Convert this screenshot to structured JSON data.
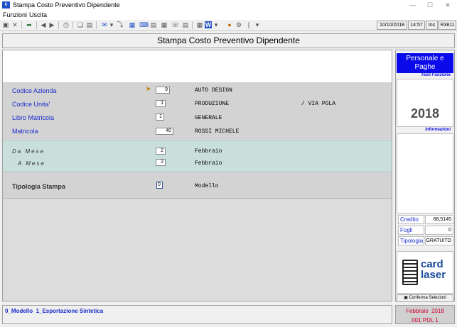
{
  "window": {
    "title": "Stampa Costo Preventivo Dipendente",
    "icon_label": "€"
  },
  "menu": [
    "Funzioni",
    "Uscita"
  ],
  "toolbar": {
    "date": "10/10/2018",
    "time": "14:57",
    "mode": "Ins",
    "code": "R3811"
  },
  "page_title": "Stampa Costo Preventivo Dipendente",
  "fields": [
    {
      "label": "Codice Azienda",
      "value": "9",
      "description": "AUTO DESIGN",
      "extra": ""
    },
    {
      "label": "Codice Unita'",
      "value": "1",
      "description": "PRODUZIONE",
      "extra": "/ VIA POLA"
    },
    {
      "label": "Libro Matricola",
      "value": "1",
      "description": "GENERALE",
      "extra": ""
    },
    {
      "label": "Matricola",
      "value": "40",
      "description": "ROSSI MICHELE",
      "extra": ""
    }
  ],
  "period": {
    "da_label": "Da Mese",
    "da_value": "2",
    "da_desc": "Febbraio",
    "a_label": "A Mese",
    "a_value": "2",
    "a_desc": "Febbraio"
  },
  "tipologia": {
    "label": "Tipologia Stampa",
    "value": "0",
    "desc": "Modello"
  },
  "right_panel": {
    "brand": "Personale e Paghe",
    "tasti": "Tasti Funzione",
    "year": "2018",
    "info": "Informazioni",
    "credito_label": "Credito",
    "credito_value": "88,5145",
    "fogli_label": "Fogli",
    "fogli_value": "0",
    "tipologia_label": "Tipologia",
    "tipologia_value": "GRATUITO",
    "logo_top": "card",
    "logo_bottom": "laser",
    "conferma": "Conferma Selezioni"
  },
  "bottom": {
    "options": "0_Modello  1_Esportazione Sintetica",
    "period": "Febbraio  2018",
    "code": "001 PDL 1"
  },
  "colors": {
    "accent_blue": "#1a2ccc",
    "brand_blue": "#0a0aea",
    "period_red": "#d00030",
    "teal": "#c9dfdc"
  }
}
